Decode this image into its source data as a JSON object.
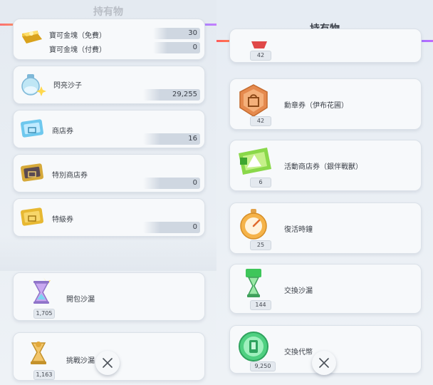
{
  "left_panel": {
    "title": "持有物",
    "items": [
      {
        "name": "寶可金塊（免費）",
        "amount": "30",
        "icon": "gold-bar-icon"
      },
      {
        "name": "寶可金塊（付費）",
        "amount": "0"
      },
      {
        "name": "閃亮沙子",
        "amount": "29,255",
        "icon": "shiny-sand-icon"
      },
      {
        "name": "商店券",
        "amount": "16",
        "icon": "shop-ticket-icon"
      },
      {
        "name": "特別商店券",
        "amount": "0",
        "icon": "special-shop-ticket-icon"
      },
      {
        "name": "特級券",
        "amount": "0",
        "icon": "premium-ticket-icon"
      },
      {
        "name": "開包沙漏",
        "count": "1,705",
        "icon": "pack-hourglass-icon"
      },
      {
        "name": "挑戰沙漏",
        "count": "1,163",
        "icon": "challenge-hourglass-icon"
      }
    ]
  },
  "right_panel": {
    "title": "持有物",
    "items": [
      {
        "name": "",
        "count": "42",
        "icon": "red-emblem-icon"
      },
      {
        "name": "勳章券（伊布花圃）",
        "count": "42",
        "icon": "emblem-ticket-icon"
      },
      {
        "name": "活動商店券（銀伴戰獸）",
        "count": "6",
        "icon": "event-shop-ticket-icon"
      },
      {
        "name": "復活時鐘",
        "count": "25",
        "icon": "revival-clock-icon"
      },
      {
        "name": "交換沙漏",
        "count": "144",
        "icon": "trade-hourglass-icon"
      },
      {
        "name": "交換代幣",
        "count": "9,250",
        "icon": "trade-token-icon"
      }
    ]
  },
  "colors": {
    "accent_rainbow": [
      "#ff5b5b",
      "#ffa43b",
      "#ffe34d",
      "#5de08c",
      "#3fc7ff",
      "#6b7bff",
      "#c06bff"
    ]
  }
}
